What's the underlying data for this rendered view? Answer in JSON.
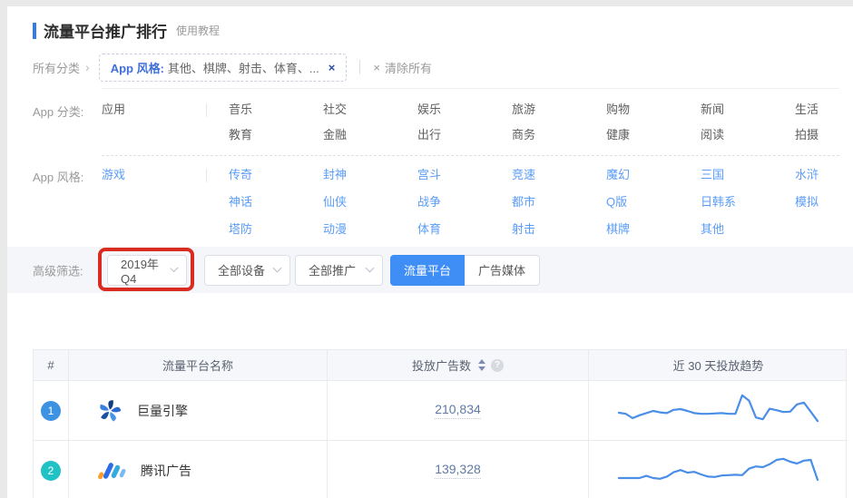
{
  "page": {
    "title": "流量平台推广排行",
    "tutorial_link": "使用教程"
  },
  "filter_summary": {
    "label": "所有分类",
    "tag_prefix": "App 风格:",
    "tag_value": "其他、棋牌、射击、体育、...",
    "tag_close": "×",
    "clear_icon": "×",
    "clear_all": "清除所有"
  },
  "app_category": {
    "label": "App 分类:",
    "primary": "应用",
    "columns": [
      [
        "音乐",
        "教育"
      ],
      [
        "社交",
        "金融"
      ],
      [
        "娱乐",
        "出行"
      ],
      [
        "旅游",
        "商务"
      ],
      [
        "购物",
        "健康"
      ],
      [
        "新闻",
        "阅读"
      ],
      [
        "生活",
        "拍摄"
      ]
    ]
  },
  "app_style": {
    "label": "App 风格:",
    "primary": "游戏",
    "columns": [
      [
        "传奇",
        "神话",
        "塔防"
      ],
      [
        "封神",
        "仙侠",
        "动漫"
      ],
      [
        "宫斗",
        "战争",
        "体育"
      ],
      [
        "竞速",
        "都市",
        "射击"
      ],
      [
        "魔幻",
        "Q版",
        "棋牌"
      ],
      [
        "三国",
        "日韩系",
        "其他"
      ],
      [
        "水浒",
        "模拟"
      ]
    ]
  },
  "advanced_filter": {
    "label": "高级筛选:",
    "dropdowns": [
      {
        "value": "2019年Q4",
        "highlighted": true
      },
      {
        "value": "全部设备",
        "highlighted": false
      },
      {
        "value": "全部推广",
        "highlighted": false
      }
    ],
    "toggle": [
      {
        "label": "流量平台",
        "active": true
      },
      {
        "label": "广告媒体",
        "active": false
      }
    ]
  },
  "table": {
    "headers": [
      "#",
      "流量平台名称",
      "投放广告数",
      "近 30 天投放趋势"
    ],
    "help_icon_text": "?",
    "rows": [
      {
        "rank": "1",
        "rank_color": "#3d92e2",
        "logo": "juliang-engine",
        "name": "巨量引擎",
        "ads_count": "210,834"
      },
      {
        "rank": "2",
        "rank_color": "#21c2c5",
        "logo": "tencent-ads",
        "name": "腾讯广告",
        "ads_count": "139,328"
      }
    ]
  },
  "colors": {
    "accent_blue": "#3e8ef5",
    "style_link_blue": "#5a9cf8",
    "sparkline": "#4a8ee8",
    "annotation_red": "#d92b1f"
  },
  "chart_data": [
    {
      "type": "line",
      "name": "巨量引擎",
      "title": "近 30 天投放趋势",
      "x_points": 30,
      "ylim": [
        0,
        100
      ],
      "grid": false,
      "values": [
        45,
        42,
        30,
        38,
        44,
        50,
        46,
        44,
        53,
        55,
        50,
        44,
        42,
        42,
        43,
        44,
        42,
        42,
        93,
        78,
        32,
        27,
        56,
        52,
        47,
        48,
        68,
        73,
        48,
        22
      ]
    },
    {
      "type": "line",
      "name": "腾讯广告",
      "title": "近 30 天投放趋势",
      "x_points": 30,
      "ylim": [
        0,
        100
      ],
      "grid": false,
      "values": [
        30,
        30,
        30,
        30,
        36,
        30,
        28,
        34,
        46,
        52,
        45,
        47,
        40,
        34,
        33,
        37,
        38,
        39,
        38,
        56,
        62,
        60,
        68,
        80,
        83,
        75,
        70,
        78,
        80,
        25
      ]
    }
  ]
}
